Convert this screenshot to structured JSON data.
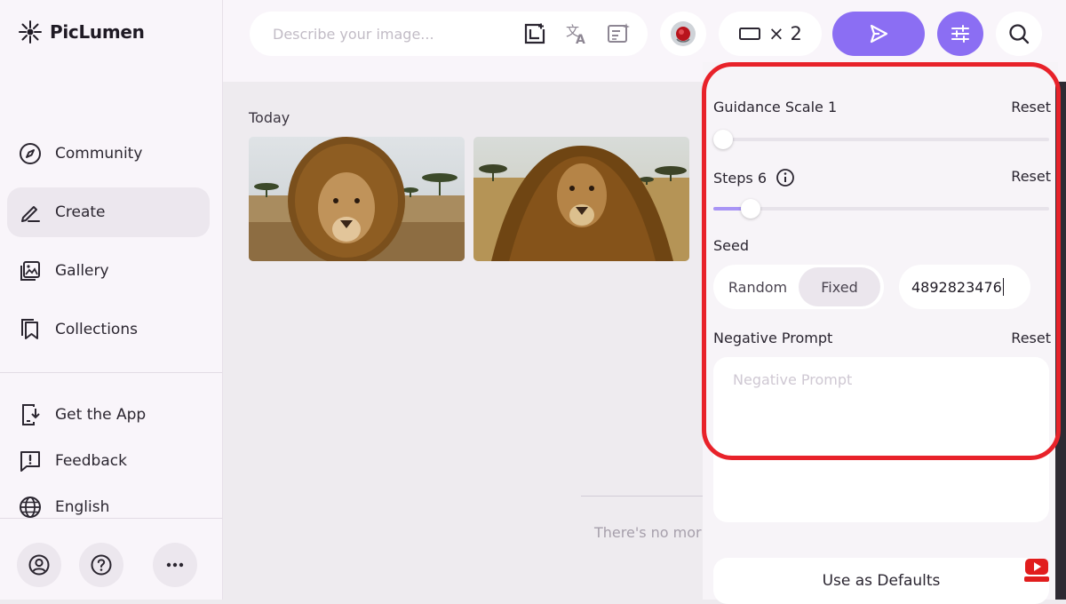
{
  "app": {
    "name": "PicLumen"
  },
  "sidebar": {
    "items": [
      {
        "label": "Community",
        "icon": "compass-icon"
      },
      {
        "label": "Create",
        "icon": "pen-icon",
        "active": true
      },
      {
        "label": "Gallery",
        "icon": "gallery-icon"
      },
      {
        "label": "Collections",
        "icon": "collections-icon"
      }
    ],
    "footer": [
      {
        "label": "Get the App",
        "icon": "download-phone-icon"
      },
      {
        "label": "Feedback",
        "icon": "feedback-icon"
      },
      {
        "label": "English",
        "icon": "globe-icon"
      }
    ],
    "bottom_buttons": [
      "account-icon",
      "help-icon",
      "more-icon"
    ]
  },
  "topbar": {
    "prompt_placeholder": "Describe your image...",
    "batch_size": "× 2",
    "accent": "#8b6ef3"
  },
  "main": {
    "section": "Today",
    "empty_text": "There's no mor"
  },
  "settings": {
    "guidance_label": "Guidance Scale 1",
    "guidance_value": 1,
    "steps_label": "Steps 6",
    "steps_value": 6,
    "reset": "Reset",
    "seed_label": "Seed",
    "seed_random": "Random",
    "seed_fixed": "Fixed",
    "seed_value": "4892823476",
    "negative_label": "Negative Prompt",
    "negative_placeholder": "Negative Prompt",
    "defaults_button": "Use as Defaults"
  },
  "overlay": {
    "highlight_color": "#e8222a"
  }
}
